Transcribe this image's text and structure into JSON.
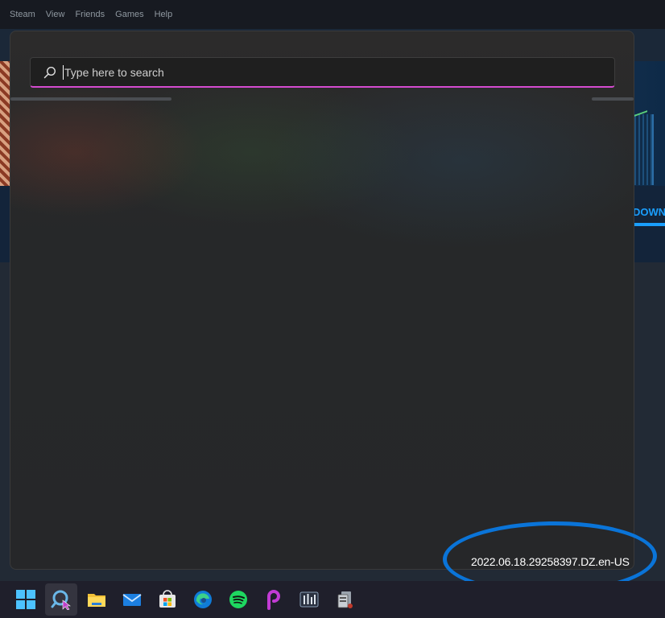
{
  "steam_menu": {
    "items": [
      "Steam",
      "View",
      "Friends",
      "Games",
      "Help"
    ]
  },
  "steam_bg": {
    "download_label": "DOWN"
  },
  "search": {
    "placeholder": "Type here to search",
    "value": ""
  },
  "search_panel": {
    "version": "2022.06.18.29258397.DZ.en-US"
  },
  "taskbar": {
    "items": [
      {
        "icon": "windows-start-icon"
      },
      {
        "icon": "search-icon",
        "active": true
      },
      {
        "icon": "file-explorer-icon"
      },
      {
        "icon": "mail-icon"
      },
      {
        "icon": "microsoft-store-icon"
      },
      {
        "icon": "edge-icon"
      },
      {
        "icon": "spotify-icon"
      },
      {
        "icon": "picsart-icon"
      },
      {
        "icon": "audio-mixer-icon"
      },
      {
        "icon": "steam-app-icon"
      }
    ]
  },
  "colors": {
    "accent_pink": "#d44bd0",
    "annotation_blue": "#0a74d8",
    "steam_blue": "#1a9fff"
  }
}
